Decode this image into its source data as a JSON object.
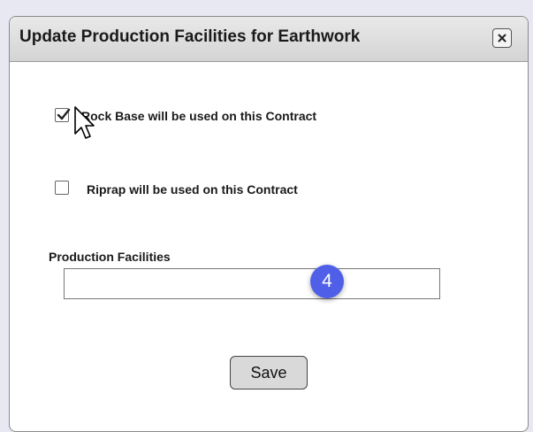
{
  "dialog": {
    "title": "Update Production Facilities for Earthwork",
    "close_icon": "close-icon"
  },
  "options": {
    "rock_base": {
      "label": "Rock Base will be used on this Contract",
      "checked": true
    },
    "riprap": {
      "label": "Riprap will be used on this Contract",
      "checked": false
    }
  },
  "production_facilities": {
    "label": "Production Facilities",
    "value": ""
  },
  "step_badge": {
    "number": "4",
    "color": "#4f5fe8"
  },
  "actions": {
    "save_label": "Save"
  },
  "cursor_icon": "arrow-pointer-icon"
}
